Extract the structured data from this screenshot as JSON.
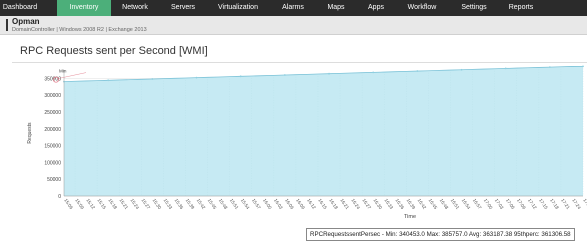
{
  "nav": {
    "items": [
      {
        "label": "Dashboard",
        "active": false
      },
      {
        "label": "Inventory",
        "active": true
      },
      {
        "label": "Network",
        "active": false
      },
      {
        "label": "Servers",
        "active": false
      },
      {
        "label": "Virtualization",
        "active": false
      },
      {
        "label": "Alarms",
        "active": false
      },
      {
        "label": "Maps",
        "active": false
      },
      {
        "label": "Apps",
        "active": false
      },
      {
        "label": "Workflow",
        "active": false
      },
      {
        "label": "Settings",
        "active": false
      },
      {
        "label": "Reports",
        "active": false
      }
    ],
    "active_color": "#4caf7a",
    "bar_color": "#2b2b2b"
  },
  "device": {
    "name": "Opman",
    "meta": "DomainController | Windows 2008 R2 | Exchange 2013"
  },
  "panel": {
    "title": "RPC Requests sent per Second [WMI]"
  },
  "chart_data": {
    "type": "area",
    "ylabel": "Requests",
    "xlabel": "Time",
    "ylim": [
      0,
      375000
    ],
    "yticks": [
      0,
      50000,
      100000,
      150000,
      200000,
      250000,
      300000,
      350000
    ],
    "x": [
      "15:06",
      "15:09",
      "15:12",
      "15:15",
      "15:18",
      "15:21",
      "15:24",
      "15:27",
      "15:30",
      "15:33",
      "15:36",
      "15:39",
      "15:42",
      "15:45",
      "15:48",
      "15:51",
      "15:54",
      "15:57",
      "16:00",
      "16:03",
      "16:06",
      "16:09",
      "16:12",
      "16:15",
      "16:18",
      "16:21",
      "16:24",
      "16:27",
      "16:30",
      "16:33",
      "16:36",
      "16:39",
      "16:42",
      "16:45",
      "16:48",
      "16:51",
      "16:54",
      "16:57",
      "17:00",
      "17:03",
      "17:06",
      "17:09",
      "17:12",
      "17:15",
      "17:18",
      "17:21",
      "17:24",
      "17:27"
    ],
    "values": [
      340453,
      341435,
      342417,
      343399,
      344381,
      345363,
      346345,
      347327,
      348309,
      349291,
      350273,
      351255,
      352237,
      353219,
      354201,
      355183,
      356165,
      357147,
      358129,
      359111,
      360093,
      361075,
      362057,
      363039,
      364021,
      365003,
      365985,
      366967,
      367949,
      368931,
      369913,
      370895,
      371877,
      372859,
      373841,
      374823,
      375805,
      376787,
      377769,
      378751,
      379733,
      380715,
      381697,
      382679,
      383661,
      384643,
      385625,
      385757
    ],
    "min_label": "Min",
    "fill_color": "#c6eaf3",
    "line_color": "#7cc3d8",
    "grid": true,
    "legend": "RPCRequestssentPersec - Min: 340453.0 Max: 385757.0 Avg: 363187.38 95thperc: 361306.58"
  }
}
